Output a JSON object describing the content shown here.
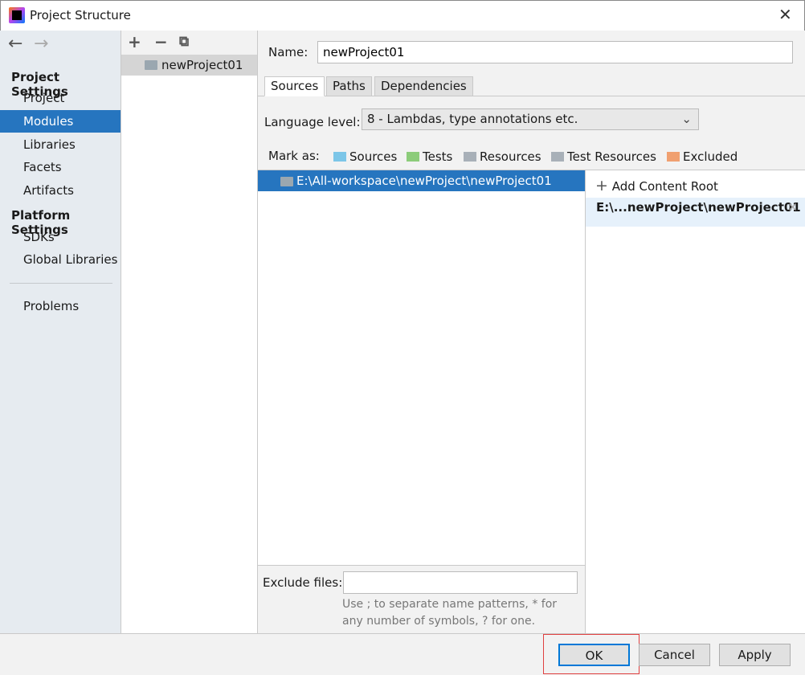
{
  "window": {
    "title": "Project Structure",
    "close": "✕"
  },
  "sidebar": {
    "back": "←",
    "forward": "→",
    "project_settings": "Project Settings",
    "platform_settings": "Platform Settings",
    "items": [
      {
        "label": "Project"
      },
      {
        "label": "Modules"
      },
      {
        "label": "Libraries"
      },
      {
        "label": "Facets"
      },
      {
        "label": "Artifacts"
      },
      {
        "label": "SDKs"
      },
      {
        "label": "Global Libraries"
      },
      {
        "label": "Problems"
      }
    ],
    "selected": "Modules"
  },
  "modules": {
    "add": "+",
    "remove": "−",
    "copy": "⧉",
    "items": [
      "newProject01"
    ]
  },
  "main": {
    "name_label": "Name:",
    "name_value": "newProject01",
    "tabs": [
      {
        "label": "Sources"
      },
      {
        "label": "Paths"
      },
      {
        "label": "Dependencies"
      }
    ],
    "language_label": "Language level:",
    "language_value": "8 - Lambdas, type annotations etc.",
    "mark_as_label": "Mark as:",
    "mark_as": [
      {
        "label": "Sources",
        "color": "#7cc6e8"
      },
      {
        "label": "Tests",
        "color": "#8ccc7a"
      },
      {
        "label": "Resources",
        "color": "#a8b0b8"
      },
      {
        "label": "Test Resources",
        "color": "#a8b0b8"
      },
      {
        "label": "Excluded",
        "color": "#f0a070"
      }
    ],
    "tree_root": "E:\\All-workspace\\newProject\\newProject01",
    "add_content_root": "Add Content Root",
    "content_root": "E:\\...newProject\\newProject01",
    "exclude_label": "Exclude files:",
    "exclude_value": "",
    "exclude_hint": "Use ; to separate name patterns, * for any number of symbols, ? for one."
  },
  "buttons": {
    "ok": "OK",
    "cancel": "Cancel",
    "apply": "Apply"
  }
}
